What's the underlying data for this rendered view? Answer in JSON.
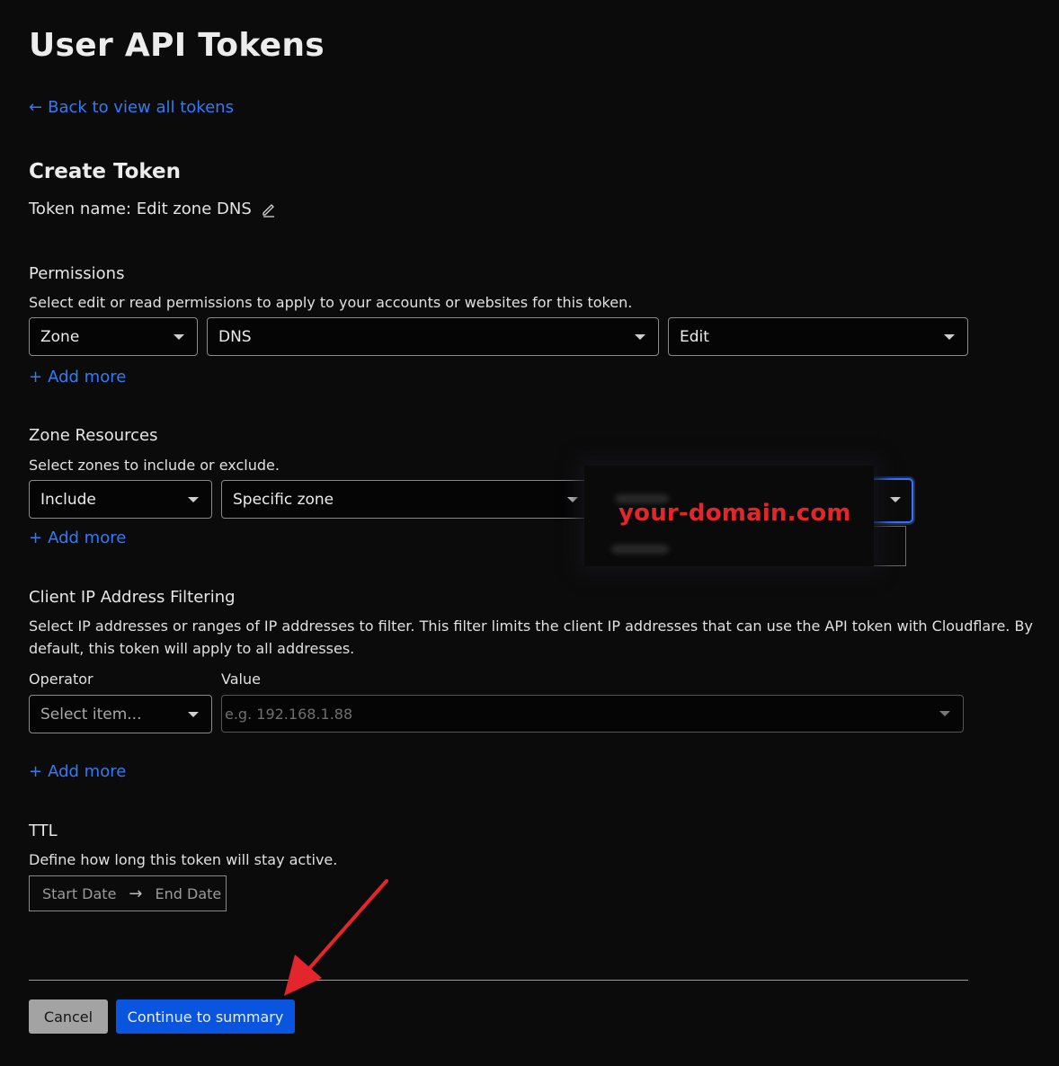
{
  "page": {
    "title": "User API Tokens",
    "back_link": "Back to view all tokens",
    "back_arrow": "←"
  },
  "create": {
    "heading": "Create Token",
    "token_name": "Token name: Edit zone DNS"
  },
  "permissions": {
    "heading": "Permissions",
    "description": "Select edit or read permissions to apply to your accounts or websites for this token.",
    "selects": [
      "Zone",
      "DNS",
      "Edit"
    ],
    "add_more": "Add more"
  },
  "zone_resources": {
    "heading": "Zone Resources",
    "description": "Select zones to include or exclude.",
    "selects": [
      "Include",
      "Specific zone"
    ],
    "domain_overlay": "your-domain.com",
    "add_more": "Add more"
  },
  "ip_filter": {
    "heading": "Client IP Address Filtering",
    "description_line1": "Select IP addresses or ranges of IP addresses to filter. This filter limits the client IP addresses that can use the API token with Cloudflare. By",
    "description_line2": "default, this token will apply to all addresses.",
    "operator_label": "Operator",
    "value_label": "Value",
    "operator_placeholder": "Select item...",
    "value_placeholder": "e.g. 192.168.1.88",
    "add_more": "Add more"
  },
  "ttl": {
    "heading": "TTL",
    "description": "Define how long this token will stay active.",
    "start_date": "Start Date",
    "end_date": "End Date",
    "arrow": "→"
  },
  "footer": {
    "cancel": "Cancel",
    "continue": "Continue to summary"
  },
  "colors": {
    "accent": "#2f7cf6",
    "primary_button": "#0a55e0",
    "annotation_red": "#e3262c"
  }
}
